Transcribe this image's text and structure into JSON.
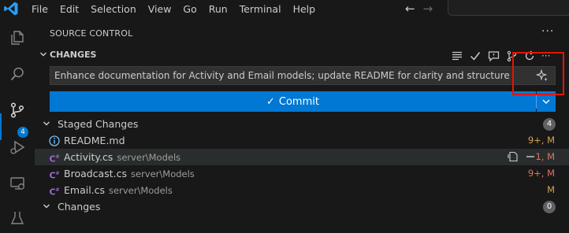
{
  "menu": [
    "File",
    "Edit",
    "Selection",
    "View",
    "Go",
    "Run",
    "Terminal",
    "Help"
  ],
  "activity_bar": {
    "source_control_badge": "4"
  },
  "panel": {
    "title": "SOURCE CONTROL",
    "more": "···"
  },
  "changes_section": {
    "label": "CHANGES",
    "more": "···"
  },
  "commit_message": "Enhance documentation for Activity and Email models; update README for clarity and structure",
  "commit_button": {
    "label": "Commit"
  },
  "staged": {
    "label": "Staged Changes",
    "count": "4",
    "files": [
      {
        "name": "README.md",
        "path": "",
        "status": "9+, M",
        "icon": "info-icon"
      },
      {
        "name": "Activity.cs",
        "path": "server\\Models",
        "status": "1, M",
        "icon": "csharp-icon"
      },
      {
        "name": "Broadcast.cs",
        "path": "server\\Models",
        "status": "9+, M",
        "icon": "csharp-icon"
      },
      {
        "name": "Email.cs",
        "path": "server\\Models",
        "status": "M",
        "icon": "csharp-icon"
      }
    ]
  },
  "changes": {
    "label": "Changes",
    "count": "0"
  },
  "colors": {
    "accent": "#0078d4",
    "modified": "#d7a24d",
    "error_count": "#e2735b",
    "highlight_box": "#e51400"
  }
}
